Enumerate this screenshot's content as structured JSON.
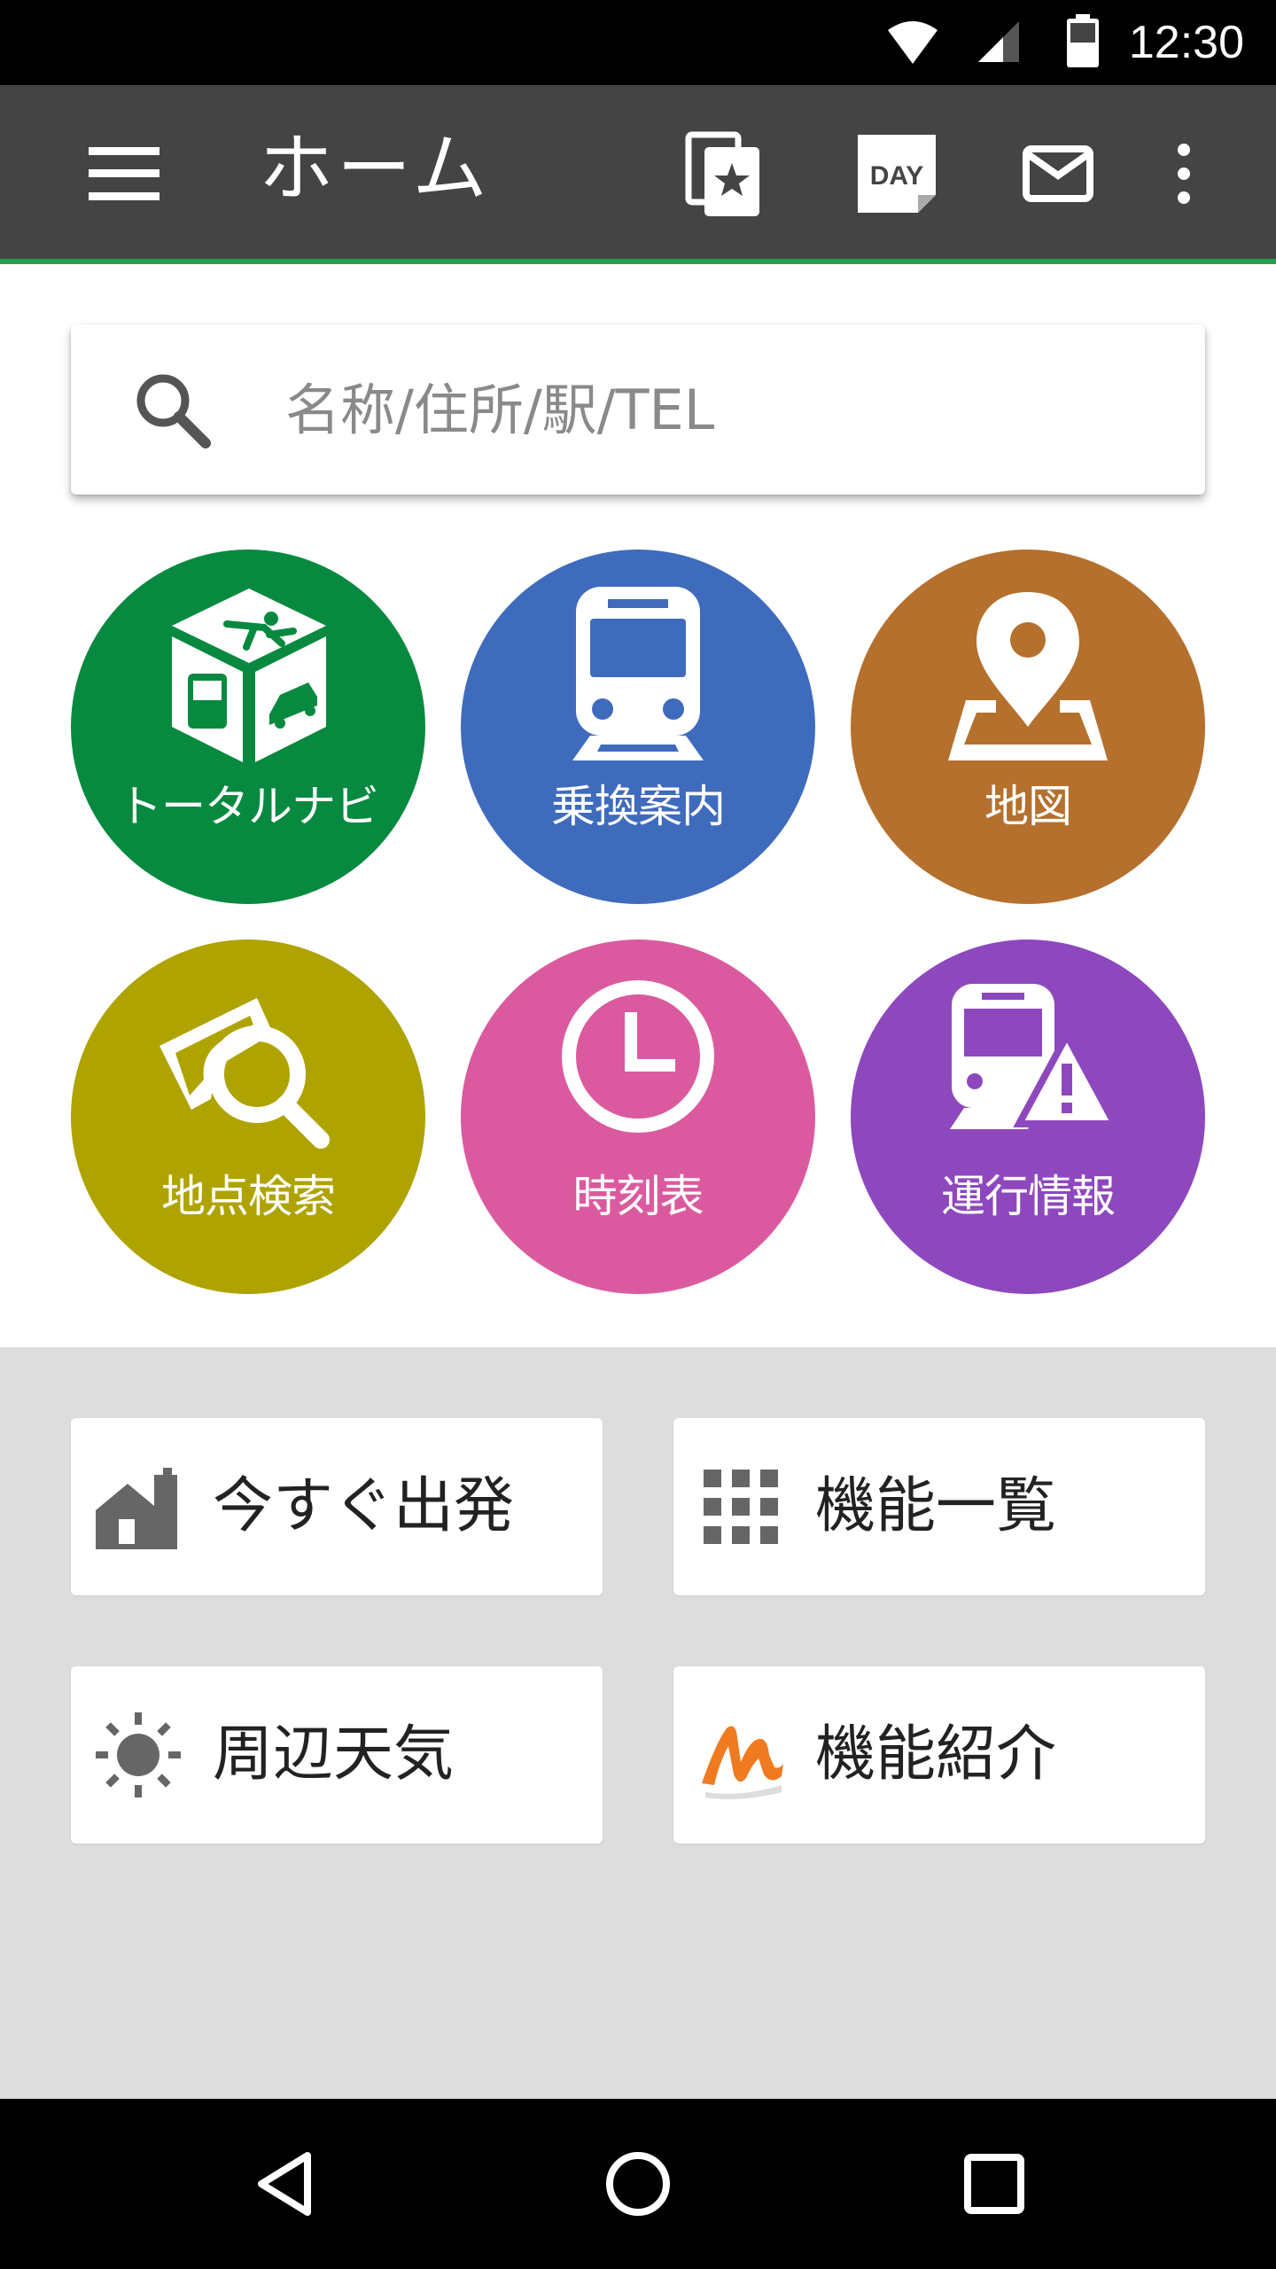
{
  "status_bar": {
    "time": "12:30"
  },
  "app_bar": {
    "title": "ホーム",
    "day_badge": "DAY"
  },
  "search": {
    "placeholder": "名称/住所/駅/TEL"
  },
  "features": [
    {
      "label": "トータルナビ",
      "color": "#078a3f"
    },
    {
      "label": "乗換案内",
      "color": "#3f6bbd"
    },
    {
      "label": "地図",
      "color": "#b5702d"
    },
    {
      "label": "地点検索",
      "color": "#afa300"
    },
    {
      "label": "時刻表",
      "color": "#db5a9f"
    },
    {
      "label": "運行情報",
      "color": "#8e48be"
    }
  ],
  "shortcuts": [
    {
      "label": "今すぐ出発",
      "icon": "house-building-icon"
    },
    {
      "label": "機能一覧",
      "icon": "grid-icon"
    },
    {
      "label": "周辺天気",
      "icon": "sun-icon"
    },
    {
      "label": "機能紹介",
      "icon": "m-logo-icon"
    }
  ],
  "colors": {
    "app_bar": "#444444",
    "accent": "#22a04a",
    "panel_bg": "#dddddd"
  }
}
